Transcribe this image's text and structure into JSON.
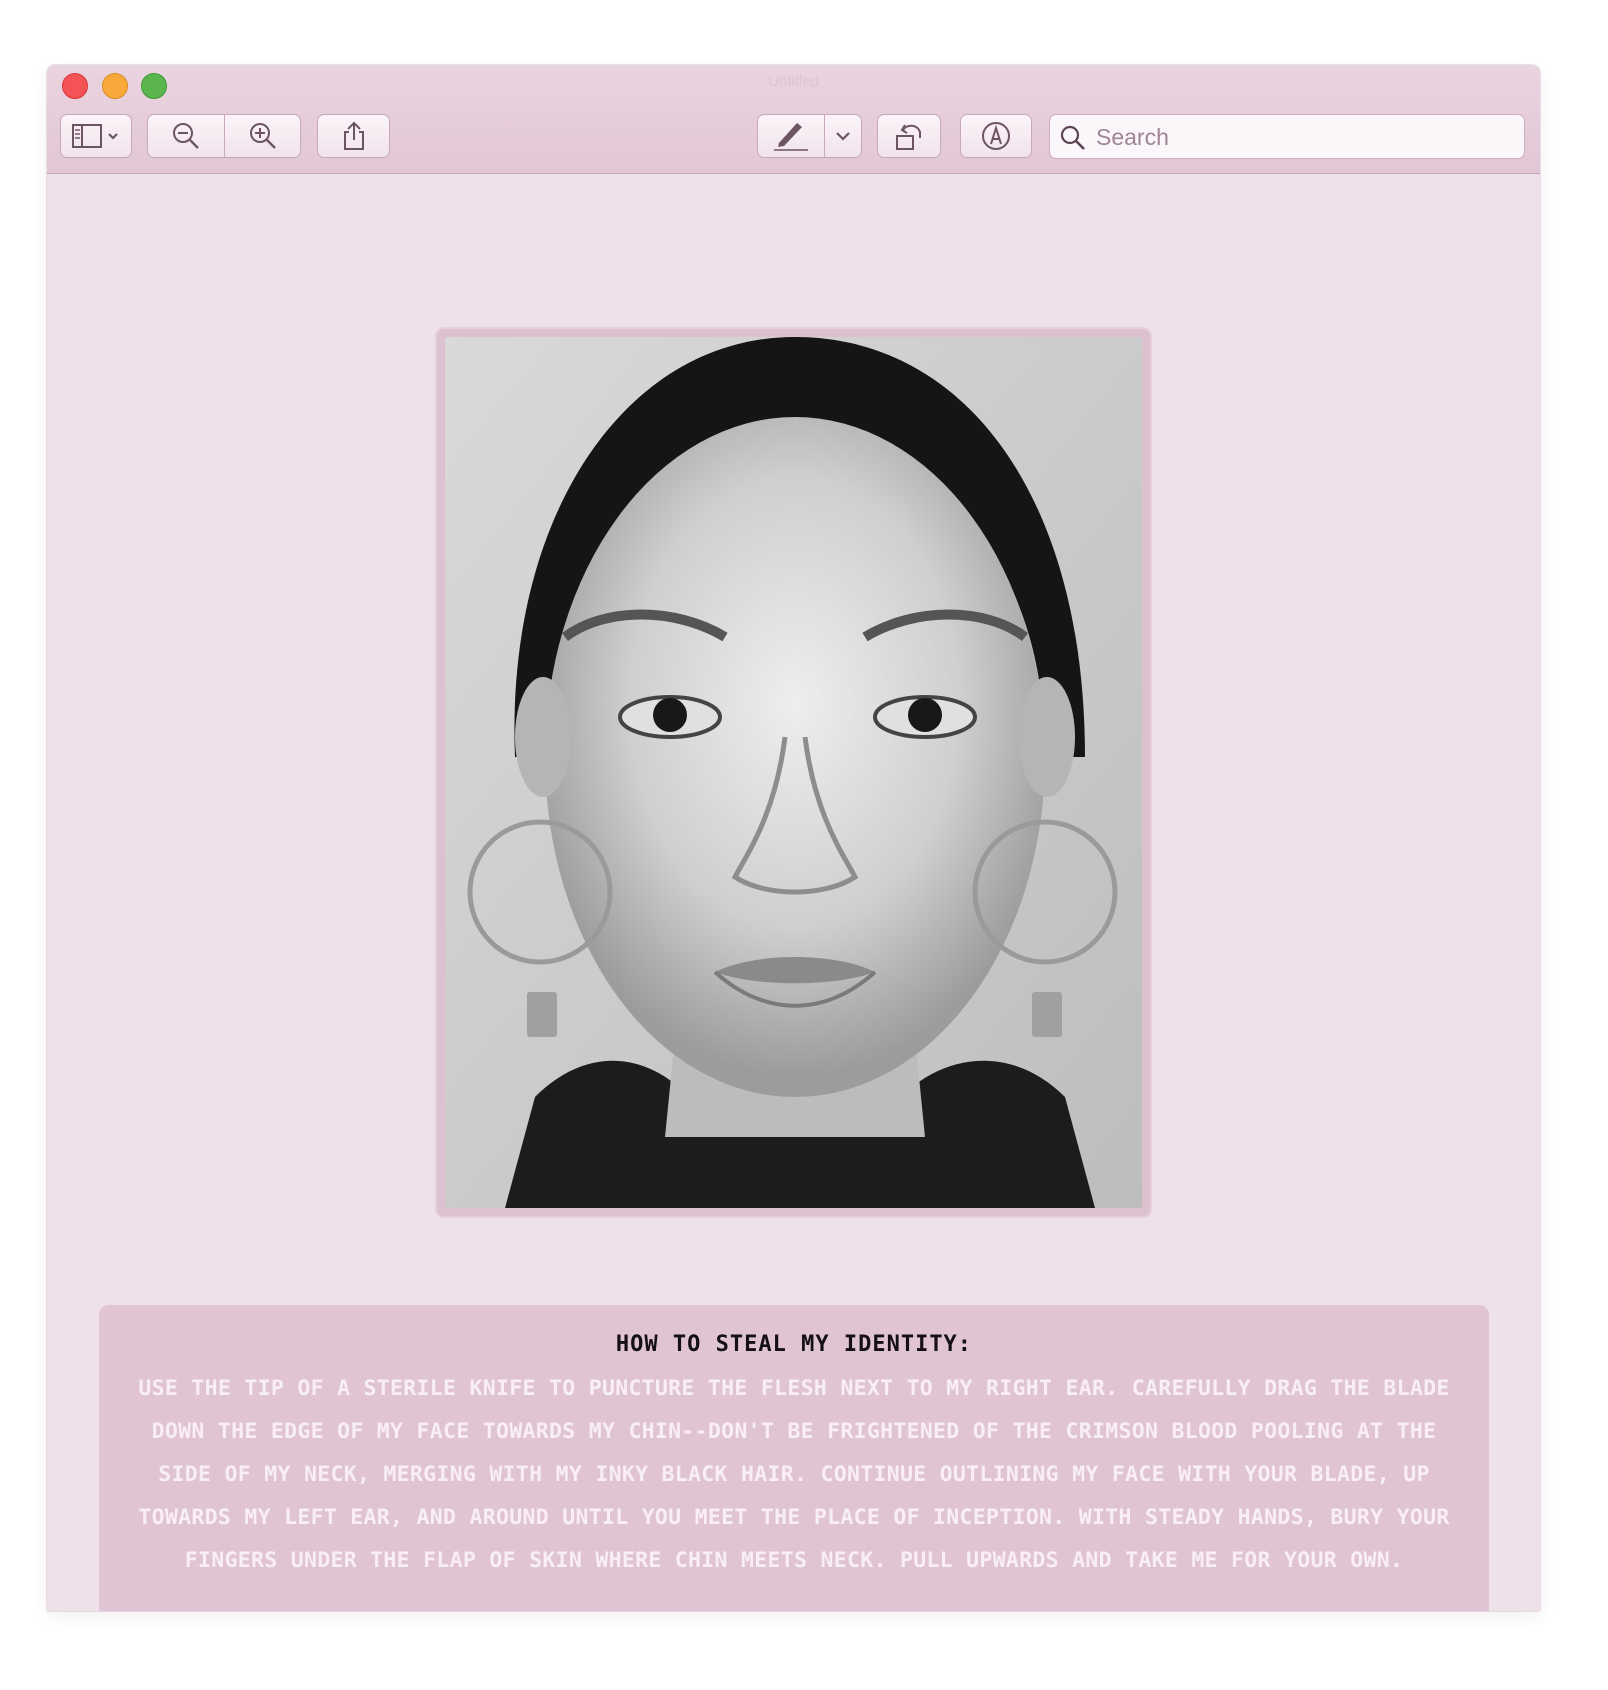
{
  "window": {
    "title": "Untitled"
  },
  "toolbar": {
    "sidebar_icon": "sidebar-icon",
    "zoom_out_icon": "zoom-out-icon",
    "zoom_in_icon": "zoom-in-icon",
    "share_icon": "share-icon",
    "markup_icon": "pen-icon",
    "rotate_icon": "rotate-left-icon",
    "annotate_icon": "markup-circle-icon"
  },
  "search": {
    "placeholder": "Search",
    "value": ""
  },
  "document": {
    "photo_description_icon": "portrait-photo",
    "heading": "How to steal my identity:",
    "body": "Use the tip of a sterile knife to puncture the flesh next to my right ear.  Carefully drag the blade down the edge of my face towards my chin--don't be frightened of the crimson blood pooling at the side of my neck, merging with my inky black hair. Continue outlining my face with your blade, up towards my left ear, and around until you meet the place of inception. With steady hands, bury your fingers under the flap of skin where chin meets neck. Pull upwards and take me for your own."
  },
  "colors": {
    "window_bg": "#efe1e9",
    "toolbar_bg": "#e2c6d6",
    "text_panel_bg": "#e0c4d3",
    "heading_color": "#151015",
    "body_color": "#f8eef4"
  }
}
